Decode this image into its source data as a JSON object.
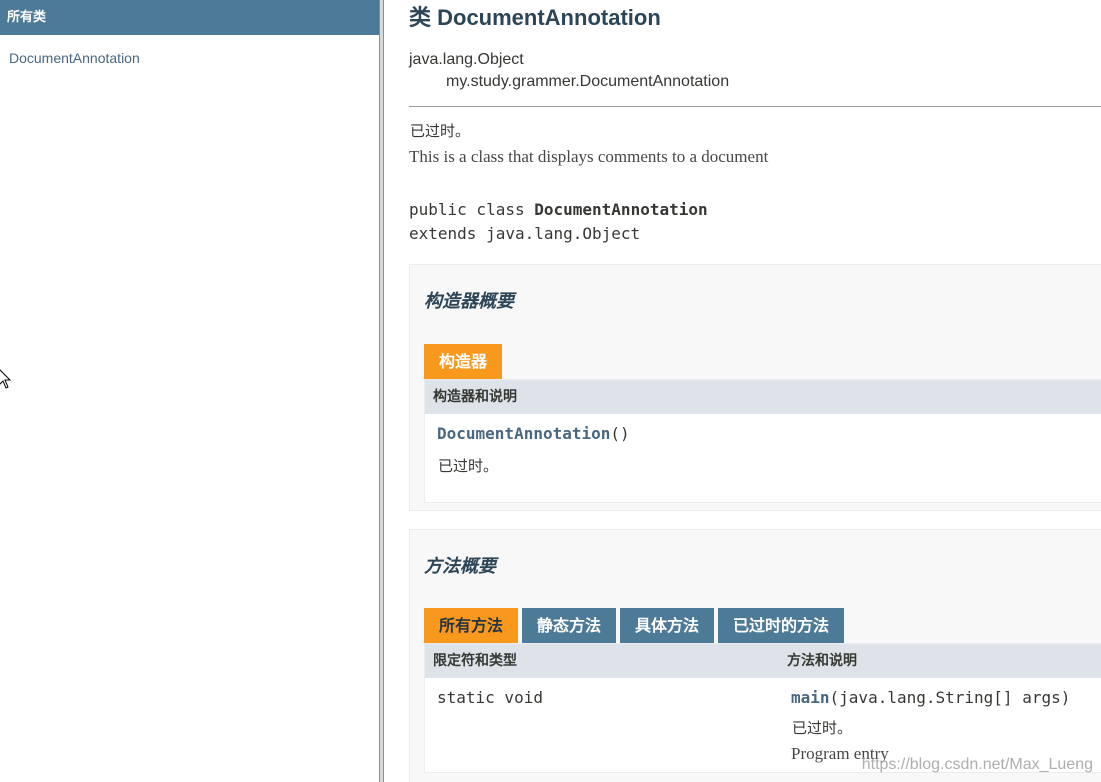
{
  "left": {
    "header": "所有类",
    "class_link": "DocumentAnnotation"
  },
  "class": {
    "title": "类 DocumentAnnotation",
    "inheritance": [
      "java.lang.Object",
      "my.study.grammer.DocumentAnnotation"
    ],
    "deprecated": "已过时。",
    "description": "This is a class that displays comments to a document",
    "signature_prefix": "public class ",
    "signature_name": "DocumentAnnotation",
    "signature_extends": "extends java.lang.Object"
  },
  "constructor_summary": {
    "title": "构造器概要",
    "tab": "构造器",
    "header": "构造器和说明",
    "row": {
      "name": "DocumentAnnotation",
      "params": "()",
      "deprecated": "已过时。"
    }
  },
  "method_summary": {
    "title": "方法概要",
    "tabs": [
      "所有方法",
      "静态方法",
      "具体方法",
      "已过时的方法"
    ],
    "headers": [
      "限定符和类型",
      "方法和说明"
    ],
    "row": {
      "modifier": "static void",
      "name": "main",
      "params": "(java.lang.String[] args)",
      "deprecated": "已过时。",
      "description": "Program entry"
    }
  },
  "watermark": "https://blog.csdn.net/Max_Lueng",
  "colors": {
    "header_blue": "#4d7a97",
    "tab_orange": "#f8981d",
    "link_blue": "#4a6782",
    "table_header": "#dee3e9"
  }
}
